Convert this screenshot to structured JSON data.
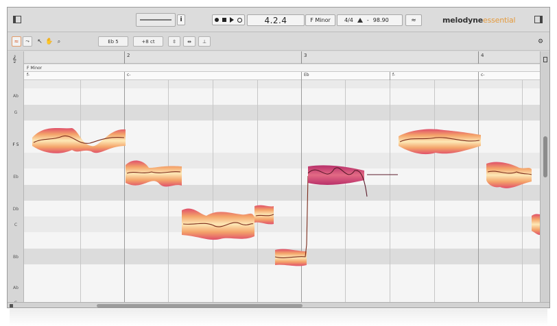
{
  "app": {
    "logo_main": "melodyne",
    "logo_sub": "essential"
  },
  "transport": {
    "position": "4.2.4",
    "key": "F Minor",
    "time_signature": "4/4",
    "tempo": "98.90"
  },
  "toolbar": {
    "pitch_field": "Eb 5",
    "cents_field": "+8 ct"
  },
  "ruler": {
    "bars": [
      "2",
      "3",
      "4"
    ]
  },
  "scale_label": "F Minor",
  "chords": [
    "f-",
    "c-",
    "Eb",
    "f-",
    "c-"
  ],
  "pitches": [
    "Ab",
    "G",
    "F 5",
    "Eb",
    "Db",
    "C",
    "Bb",
    "Ab",
    "G"
  ],
  "colors": {
    "accent": "#e59a3c",
    "blob_light": "#fde6b0",
    "blob_mid": "#f0a46a",
    "blob_dark": "#c0366a"
  }
}
